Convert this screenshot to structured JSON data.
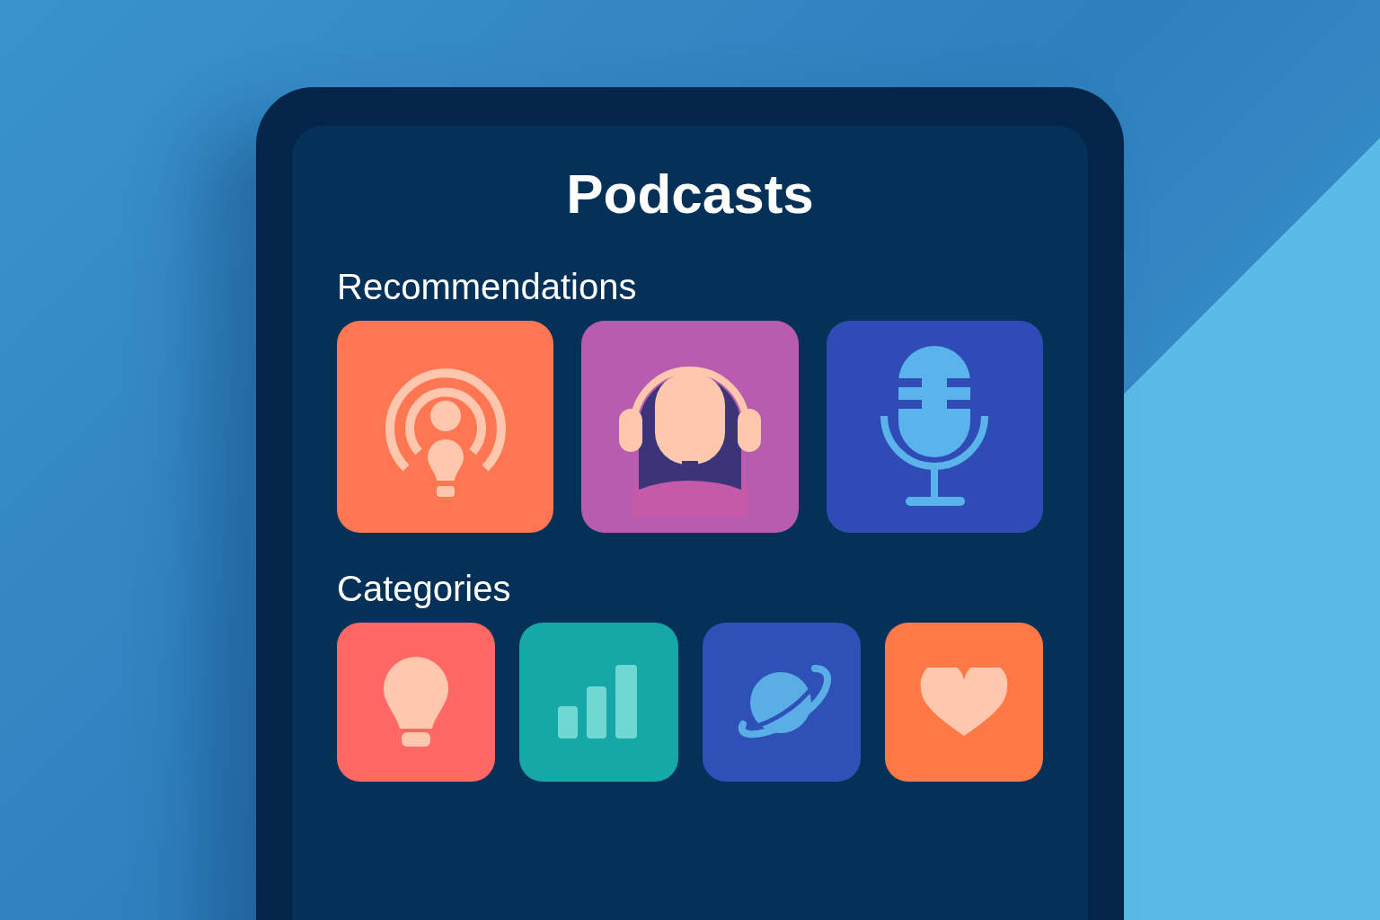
{
  "title": "Podcasts",
  "sections": [
    {
      "heading": "Recommendations",
      "kind": "large",
      "tiles": [
        {
          "kind": "podcast",
          "color": "#ff7752"
        },
        {
          "kind": "listener",
          "color": "#b85cb0"
        },
        {
          "kind": "microphone",
          "color": "#2f4cb6"
        }
      ]
    },
    {
      "heading": "Categories",
      "kind": "small",
      "tiles": [
        {
          "kind": "bulb",
          "color": "#ff6865"
        },
        {
          "kind": "chart",
          "color": "#15a8a6"
        },
        {
          "kind": "planet",
          "color": "#2f50b6"
        },
        {
          "kind": "heart",
          "color": "#ff7845"
        }
      ]
    }
  ]
}
